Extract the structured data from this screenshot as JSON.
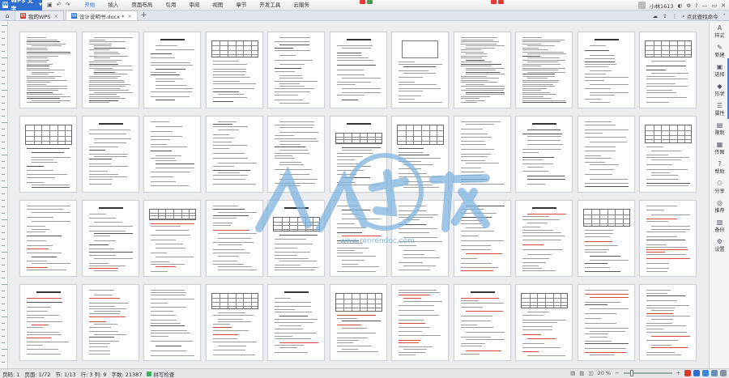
{
  "app": {
    "brand": "WPS 文字",
    "brand_logo": "W"
  },
  "menubar": {
    "items": [
      "开始",
      "插入",
      "页面布局",
      "引用",
      "审阅",
      "视图",
      "章节",
      "开发工具",
      "云服务"
    ],
    "active_index": 0,
    "user_name": "小林1613",
    "help_label": "?"
  },
  "tabs": {
    "items": [
      {
        "label": "我的WPS",
        "icon": "W",
        "type": "wps",
        "closable": true
      },
      {
        "label": "设计说明书.docx *",
        "icon": "W",
        "type": "doc",
        "closable": true
      }
    ],
    "add_label": "+",
    "search_placeholder": "点此查找命令"
  },
  "sidebar": {
    "items": [
      {
        "label": "样式",
        "icon": "A"
      },
      {
        "label": "新建",
        "icon": "✎"
      },
      {
        "label": "选择",
        "icon": "▣"
      },
      {
        "label": "形状",
        "icon": "◆"
      },
      {
        "label": "属性",
        "icon": "☰"
      },
      {
        "label": "限制",
        "icon": "▤"
      },
      {
        "label": "传图",
        "icon": "▦"
      },
      {
        "label": "帮助",
        "icon": "?"
      },
      {
        "label": "分享",
        "icon": "⚇"
      },
      {
        "label": "推荐",
        "icon": "◎"
      },
      {
        "label": "备份",
        "icon": "▧"
      },
      {
        "label": "设置",
        "icon": "⚙"
      }
    ]
  },
  "status": {
    "page_no": "页码: 1",
    "pages": "页面: 1/72",
    "section": "节: 1/13",
    "line_col": "行: 3  列: 9",
    "word_count": "字数: 21387",
    "spell_check": "拼写检查",
    "zoom": "20 %"
  },
  "watermark": {
    "text": "人人文库",
    "url": "www.renrendoc.com"
  },
  "colors": {
    "accent": "#2f6fd1",
    "wps_red": "#d9382b",
    "watermark": "#7fb4de"
  }
}
